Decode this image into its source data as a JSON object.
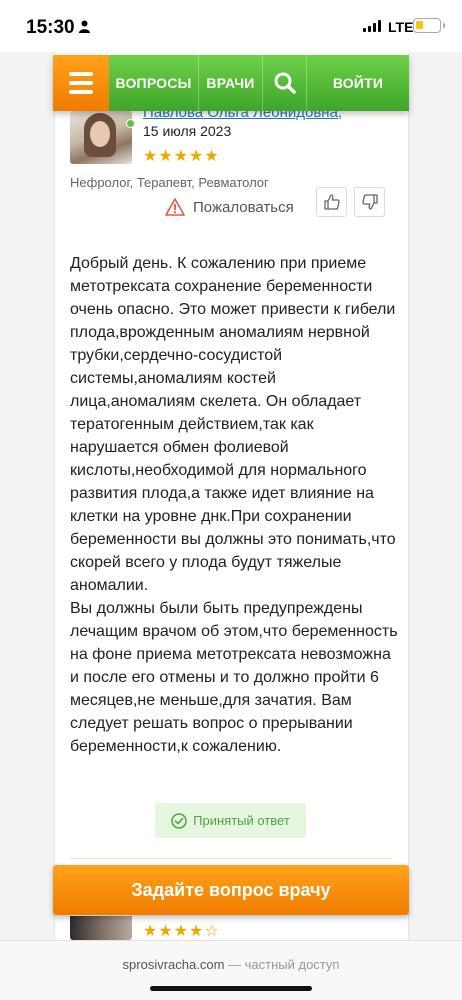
{
  "status_bar": {
    "time": "15:30",
    "network": "LTE"
  },
  "nav": {
    "questions": "ВОПРОСЫ",
    "doctors": "ВРАЧИ",
    "login": "ВОЙТИ"
  },
  "answer": {
    "doctor_name": "Павлова Ольга Леонидовна,",
    "date": "15 июля 2023",
    "rating": "★★★★★",
    "specialties": "Нефролог, Терапевт, Ревматолог",
    "complain_label": "Пожаловаться",
    "text": "Добрый день. К сожалению при приеме метотрексата сохранение беременности очень опасно. Это может привести к гибели плода,врожденным аномалиям нервной трубки,сердечно-сосудистой системы,аномалиям костей лица,аномалиям скелета. Он обладает тератогенным действием,так как нарушается обмен фолиевой кислоты,необходимой для нормального развития плода,а также идет влияние на клетки на уровне днк.При сохранении беременности вы должны это понимать,что скорей всего у плода будут тяжелые аномалии.\nВы должны были быть предупреждены лечащим врачом об этом,что беременность на фоне приема метотрексата невозможна и после его отмены и то должно пройти 6 месяцев,не меньше,для зачатия. Вам следует решать вопрос о прерывании беременности,к сожалению.",
    "accepted_label": "Принятый ответ"
  },
  "cta": {
    "label": "Задайте вопрос врачу"
  },
  "next_answer": {
    "rating": "★★★★☆"
  },
  "browser": {
    "domain": "sprosivracha.com",
    "suffix": "— частный доступ"
  },
  "colors": {
    "nav_green": "#4fb832",
    "accent_orange": "#f7900c",
    "link_blue": "#2a7ab8",
    "star_gold": "#f0a800",
    "accepted_green": "#4aa83a"
  }
}
